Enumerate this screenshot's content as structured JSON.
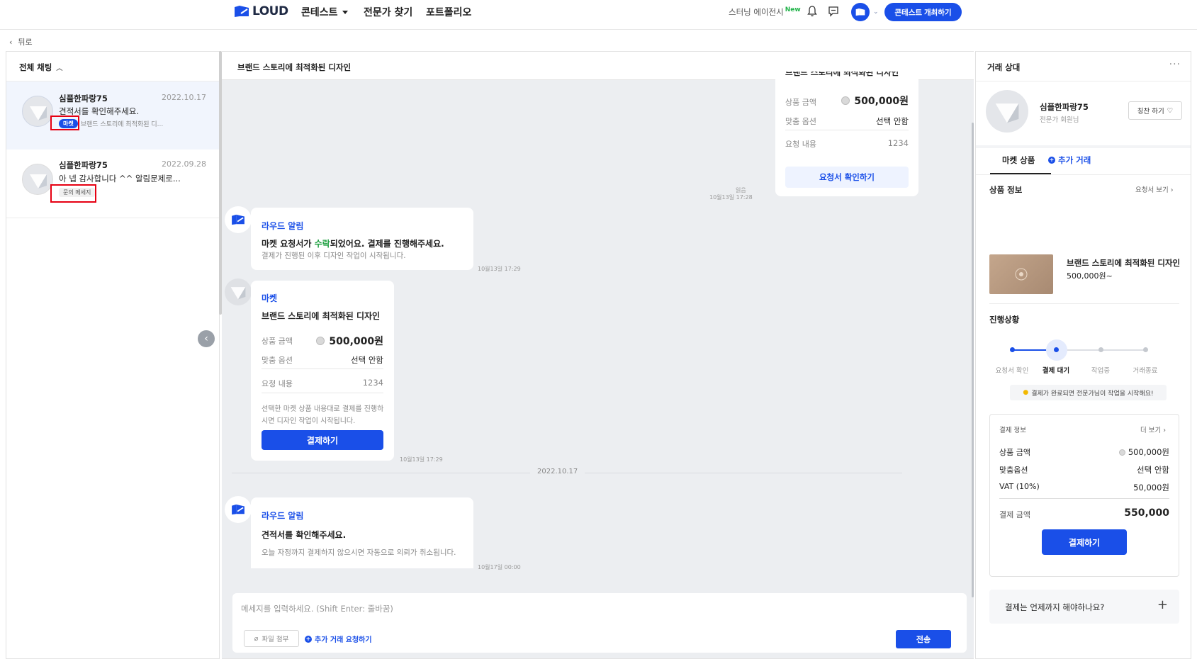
{
  "nav": {
    "logo": "LOUD",
    "contest": "콘테스트",
    "find_expert": "전문가 찾기",
    "portfolio": "포트폴리오",
    "agency": "스터닝 에이전시",
    "agency_badge": "New",
    "host_contest": "콘테스트 개최하기"
  },
  "back": "뒤로",
  "left": {
    "header": "전체 채팅",
    "items": [
      {
        "name": "심플한파랑75",
        "date": "2022.10.17",
        "message": "견적서를 확인해주세요.",
        "tag": "마켓",
        "sub": "브랜드 스토리에 최적화된 디..."
      },
      {
        "name": "심플한파랑75",
        "date": "2022.09.28",
        "message": "아 넵 감사합니다 ^^ 알림문제로...",
        "tag": "문의 메세지",
        "sub": ""
      }
    ]
  },
  "center": {
    "title": "브랜드 스토리에 최적화된 디자인",
    "top_card": {
      "title_partial": "브랜드 스토리에 최적화된 디자인",
      "price_label": "상품 금액",
      "price_value": "500,000원",
      "option_label": "맞춤 옵션",
      "option_value": "선택 안함",
      "request_label": "요청 내용",
      "request_value": "1234",
      "button": "요청서 확인하기",
      "read": "읽음",
      "time": "10월13일 17:28"
    },
    "alert1": {
      "title": "라우드 알림",
      "main_pre": "마켓 요청서가 ",
      "main_green": "수락",
      "main_post": "되었어요. 결제를 진행해주세요.",
      "sub": "결제가 진행된 이후 디자인 작업이 시작됩니다.",
      "time": "10월13일 17:29"
    },
    "market_card": {
      "title": "마켓",
      "product": "브랜드 스토리에 최적화된 디자인",
      "price_label": "상품 금액",
      "price_value": "500,000원",
      "option_label": "맞춤 옵션",
      "option_value": "선택 안함",
      "request_label": "요청 내용",
      "request_value": "1234",
      "note_line1": "선택한 마켓 상품 내용대로 결제를 진행하",
      "note_line2": "시면 디자인 작업이 시작됩니다.",
      "button": "결제하기",
      "time": "10월13일 17:29"
    },
    "date_separator": "2022.10.17",
    "alert2": {
      "title": "라우드 알림",
      "main": "견적서를 확인해주세요.",
      "sub": "오늘 자정까지 결제하지 않으시면 자동으로 의뢰가 취소됩니다.",
      "time": "10월17일 00:00"
    },
    "input": {
      "placeholder": "메세지를 입력하세요. (Shift  Enter: 줄바꿈)",
      "attach": "파일 첨부",
      "extra_request": "추가 거래 요청하기",
      "send": "전송"
    }
  },
  "right": {
    "title": "거래 상대",
    "name": "심플한파랑75",
    "role": "전문가 회원님",
    "praise": "칭찬 하기",
    "tab_market": "마켓 상품",
    "tab_extra": "추가 거래",
    "product_info": "상품 정보",
    "request_see": "요청서 보기",
    "product_name": "브랜드 스토리에 최적화된 디자인",
    "product_price": "500,000원~",
    "progress_label": "진행상황",
    "steps": [
      "요청서 확인",
      "결제 대기",
      "작업중",
      "거래종료"
    ],
    "active_step": 2,
    "notice": "결제가 완료되면 전문가님이 작업을 시작해요!",
    "pay": {
      "title": "결제 정보",
      "more": "더 보기",
      "rows": [
        {
          "label": "상품 금액",
          "value": "500,000원"
        },
        {
          "label": "맞춤옵션",
          "value": "선택 안함"
        },
        {
          "label": "VAT (10%)",
          "value": "50,000원"
        }
      ],
      "total_label": "결제 금액",
      "total_value": "550,000",
      "button": "결제하기"
    },
    "faq": "결제는 언제까지 해야하나요?"
  },
  "colors": {
    "primary": "#1a4fe8",
    "accent_green": "#1b9e3e",
    "highlight_red": "#e60012"
  }
}
